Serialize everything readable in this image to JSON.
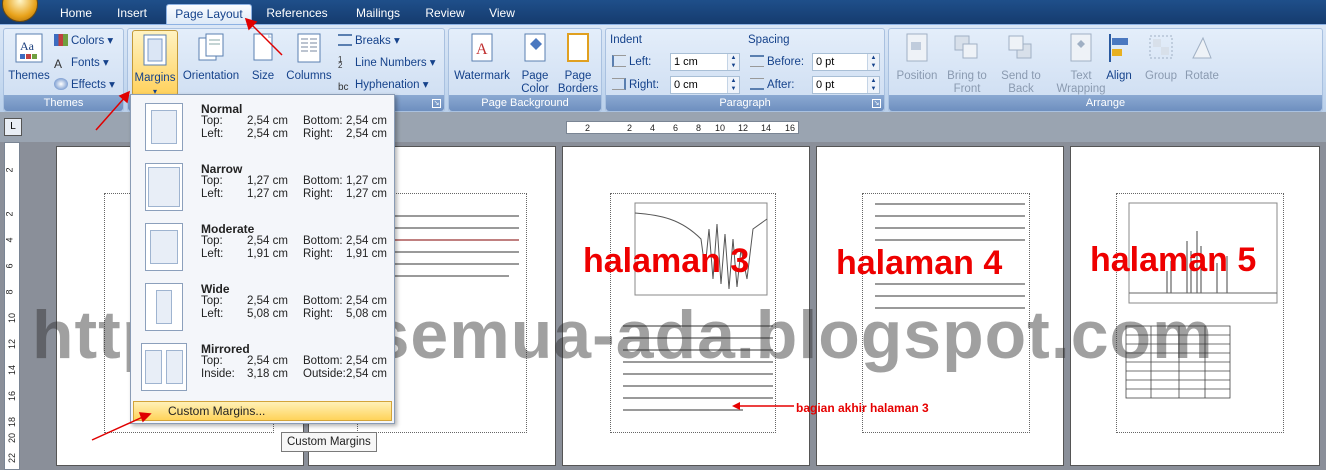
{
  "tabs": [
    {
      "label": "Home"
    },
    {
      "label": "Insert"
    },
    {
      "label": "Page Layout"
    },
    {
      "label": "References"
    },
    {
      "label": "Mailings"
    },
    {
      "label": "Review"
    },
    {
      "label": "View"
    }
  ],
  "ribbon": {
    "themes": {
      "themes_label": "Themes",
      "colors_label": "Colors",
      "fonts_label": "Fonts",
      "effects_label": "Effects",
      "group_label": "Themes"
    },
    "page_setup": {
      "margins_label": "Margins",
      "orientation_label": "Orientation",
      "size_label": "Size",
      "columns_label": "Columns",
      "breaks_label": "Breaks",
      "line_numbers_label": "Line Numbers",
      "hyphenation_label": "Hyphenation"
    },
    "page_background": {
      "watermark_label": "Watermark",
      "page_color_label_1": "Page",
      "page_color_label_2": "Color",
      "page_borders_label_1": "Page",
      "page_borders_label_2": "Borders",
      "group_label": "Page Background"
    },
    "paragraph": {
      "indent_title": "Indent",
      "left_label": "Left:",
      "left_value": "1 cm",
      "right_label": "Right:",
      "right_value": "0 cm",
      "spacing_title": "Spacing",
      "before_label": "Before:",
      "before_value": "0 pt",
      "after_label": "After:",
      "after_value": "0 pt",
      "group_label": "Paragraph"
    },
    "arrange": {
      "position_label": "Position",
      "bring_label_1": "Bring to",
      "bring_label_2": "Front",
      "send_label_1": "Send to",
      "send_label_2": "Back",
      "text_label_1": "Text",
      "text_label_2": "Wrapping",
      "align_label": "Align",
      "group_button_label": "Group",
      "rotate_label": "Rotate",
      "group_label": "Arrange"
    }
  },
  "ruler": {
    "corner_symbol": "L",
    "h_ticks": [
      "2",
      "2",
      "4",
      "6",
      "8",
      "10",
      "12",
      "14",
      "16"
    ],
    "v_ticks": [
      "2",
      "2",
      "4",
      "6",
      "8",
      "10",
      "12",
      "14",
      "16",
      "18",
      "20",
      "22"
    ]
  },
  "margins_menu": {
    "options": [
      {
        "name": "Normal",
        "k1": "Top:",
        "v1": "2,54 cm",
        "k2": "Bottom:",
        "v2": "2,54 cm",
        "k3": "Left:",
        "v3": "2,54 cm",
        "k4": "Right:",
        "v4": "2,54 cm"
      },
      {
        "name": "Narrow",
        "k1": "Top:",
        "v1": "1,27 cm",
        "k2": "Bottom:",
        "v2": "1,27 cm",
        "k3": "Left:",
        "v3": "1,27 cm",
        "k4": "Right:",
        "v4": "1,27 cm"
      },
      {
        "name": "Moderate",
        "k1": "Top:",
        "v1": "2,54 cm",
        "k2": "Bottom:",
        "v2": "2,54 cm",
        "k3": "Left:",
        "v3": "1,91 cm",
        "k4": "Right:",
        "v4": "1,91 cm"
      },
      {
        "name": "Wide",
        "k1": "Top:",
        "v1": "2,54 cm",
        "k2": "Bottom:",
        "v2": "2,54 cm",
        "k3": "Left:",
        "v3": "5,08 cm",
        "k4": "Right:",
        "v4": "5,08 cm"
      },
      {
        "name": "Mirrored",
        "k1": "Top:",
        "v1": "2,54 cm",
        "k2": "Bottom:",
        "v2": "2,54 cm",
        "k3": "Inside:",
        "v3": "3,18 cm",
        "k4": "Outside:",
        "v4": "2,54 cm"
      }
    ],
    "custom_label": "Custom Margins...",
    "tooltip": "Custom Margins"
  },
  "document": {
    "page3_label": "halaman 3",
    "page4_label": "halaman 4",
    "page5_label": "halaman 5",
    "annotation": "bagian akhir halaman 3",
    "watermark": "http://ada-semua-ada.blogspot.com"
  },
  "colors": {
    "accent": "#15428b",
    "highlight": "#ffd15c",
    "annotation": "#e60000"
  }
}
